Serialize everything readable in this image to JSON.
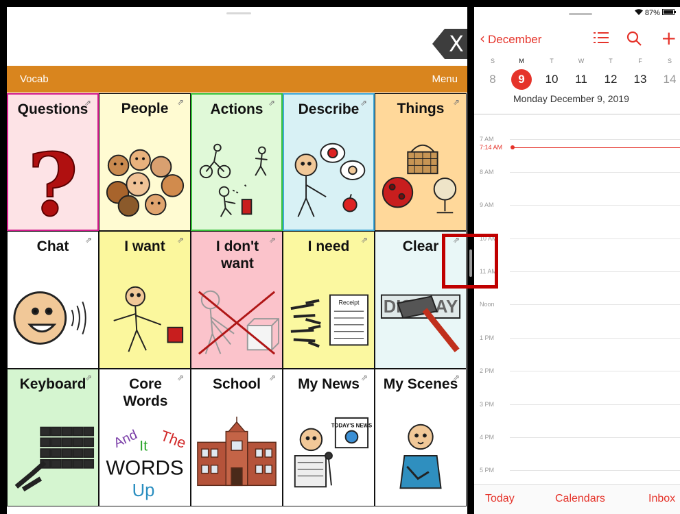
{
  "vocab_app": {
    "close_glyph": "X",
    "toolbar": {
      "vocab": "Vocab",
      "menu": "Menu"
    },
    "link_glyph": "⇗",
    "cells": [
      {
        "label": "Questions",
        "bg": "#fde3e6"
      },
      {
        "label": "People",
        "bg": "#fffbd2"
      },
      {
        "label": "Actions",
        "bg": "#e0f9d8"
      },
      {
        "label": "Describe",
        "bg": "#d8f1f5"
      },
      {
        "label": "Things",
        "bg": "#ffd89a"
      },
      {
        "label": "Chat",
        "bg": "#ffffff"
      },
      {
        "label": "I want",
        "bg": "#fbf79d"
      },
      {
        "label": "I don't want",
        "bg": "#fbc3cb"
      },
      {
        "label": "I need",
        "bg": "#fbf8a0"
      },
      {
        "label": "Clear",
        "bg": "#e9f7f7"
      },
      {
        "label": "Keyboard",
        "bg": "#d5f5d0"
      },
      {
        "label": "Core Words",
        "bg": "#ffffff"
      },
      {
        "label": "School",
        "bg": "#ffffff"
      },
      {
        "label": "My News",
        "bg": "#ffffff"
      },
      {
        "label": "My Scenes",
        "bg": "#ffffff"
      }
    ],
    "core_words_text": {
      "w1": "And",
      "w2": "It",
      "w3": "The",
      "w4": "WORDS",
      "w5": "Up"
    },
    "pictures": {
      "news_sign": "TODAY'S NEWS",
      "receipt": "Receipt",
      "display_word": "DISPLAY"
    }
  },
  "calendar_app": {
    "status": {
      "wifi": "wifi-icon",
      "battery_percent": "87%"
    },
    "nav": {
      "back_label": "December",
      "chevron": "‹",
      "add_glyph": "+"
    },
    "week": [
      {
        "letter": "S",
        "day": "8"
      },
      {
        "letter": "M",
        "day": "9",
        "today": true
      },
      {
        "letter": "T",
        "day": "10"
      },
      {
        "letter": "W",
        "day": "11"
      },
      {
        "letter": "T",
        "day": "12"
      },
      {
        "letter": "F",
        "day": "13"
      },
      {
        "letter": "S",
        "day": "14"
      }
    ],
    "selected_date": "Monday  December 9, 2019",
    "now_label": "7:14 AM",
    "hours": [
      "7 AM",
      "8 AM",
      "9 AM",
      "10 AM",
      "11 AM",
      "Noon",
      "1 PM",
      "2 PM",
      "3 PM",
      "4 PM",
      "5 PM"
    ],
    "tabs": {
      "today": "Today",
      "calendars": "Calendars",
      "inbox": "Inbox"
    },
    "accent": "#e5332a"
  },
  "annotation": {
    "color": "#c00000"
  }
}
